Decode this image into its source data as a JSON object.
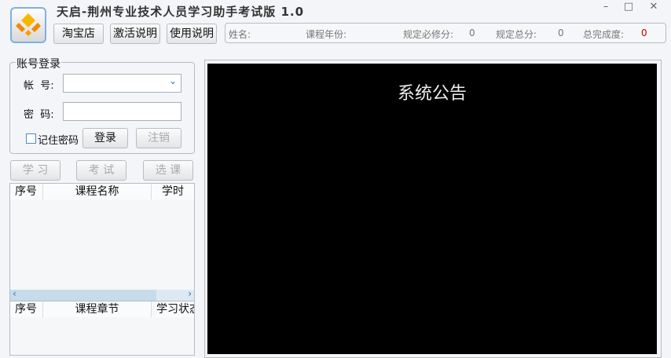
{
  "window": {
    "title": "天启-荆州专业技术人员学习助手考试版 1.0",
    "minimize": "–",
    "maximize": "□",
    "close": "✕"
  },
  "toolbar": {
    "taobao": "淘宝店",
    "activate": "激活说明",
    "usage": "使用说明"
  },
  "info": {
    "name_label": "姓名:",
    "year_label": "课程年份:",
    "required_label": "规定必修分:",
    "required_value": "0",
    "total_label": "规定总分:",
    "total_value": "0",
    "completion_label": "总完成度:",
    "completion_value": "0"
  },
  "colors": {
    "completion": "#c00000",
    "notice_bg": "#000000"
  },
  "login": {
    "legend": "账号登录",
    "account_label": "帐  号:",
    "account_value": "",
    "password_label": "密  码:",
    "password_value": "",
    "remember": "记住密码",
    "login": "登录",
    "logout": "注销"
  },
  "actions": {
    "study": "学 习",
    "exam": "考 试",
    "select": "选 课"
  },
  "courses": {
    "columns": [
      "序号",
      "课程名称",
      "学时"
    ]
  },
  "chapters": {
    "columns": [
      "序号",
      "课程章节",
      "学习状态"
    ]
  },
  "notice": {
    "title": "系统公告"
  }
}
